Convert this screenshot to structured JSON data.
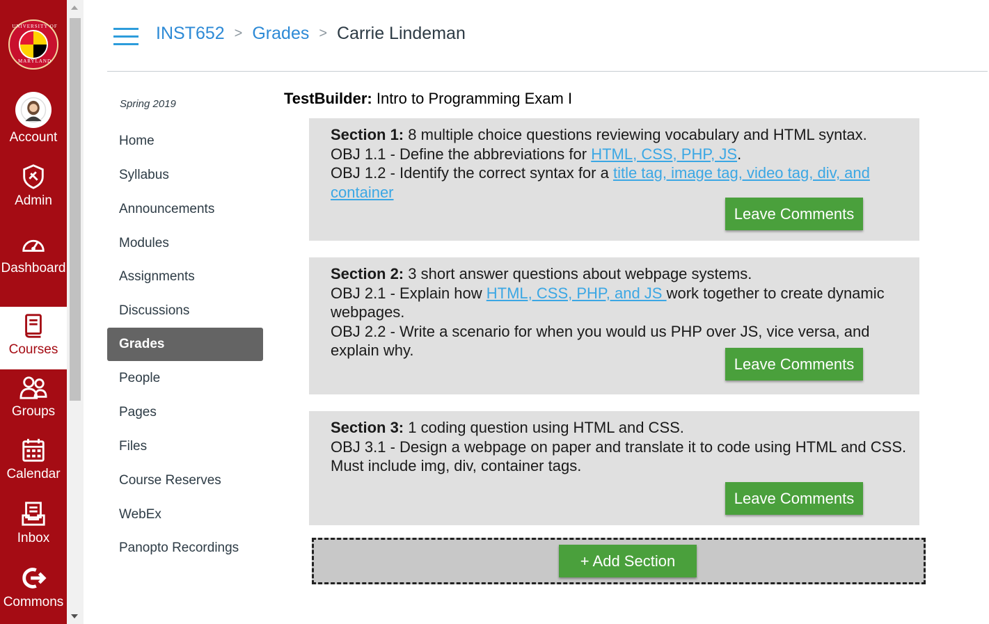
{
  "global_nav": {
    "logo": {
      "top_text": "UNIVERSITY OF",
      "bottom_text": "MARYLAND"
    },
    "items": [
      {
        "label": "Account",
        "icon": "user-avatar-icon"
      },
      {
        "label": "Admin",
        "icon": "shield-icon"
      },
      {
        "label": "Dashboard",
        "icon": "speedometer-icon"
      },
      {
        "label": "Courses",
        "icon": "book-icon",
        "active": true
      },
      {
        "label": "Groups",
        "icon": "people-icon"
      },
      {
        "label": "Calendar",
        "icon": "calendar-icon"
      },
      {
        "label": "Inbox",
        "icon": "inbox-icon"
      },
      {
        "label": "Commons",
        "icon": "share-arrow-icon"
      }
    ]
  },
  "breadcrumb": {
    "course": "INST652",
    "page": "Grades",
    "student": "Carrie Lindeman",
    "separator": ">"
  },
  "course_nav": {
    "term": "Spring 2019",
    "items": [
      "Home",
      "Syllabus",
      "Announcements",
      "Modules",
      "Assignments",
      "Discussions",
      "Grades",
      "People",
      "Pages",
      "Files",
      "Course Reserves",
      "WebEx",
      "Panopto Recordings"
    ],
    "active": "Grades"
  },
  "testbuilder": {
    "label": "TestBuilder:",
    "title": "Intro to Programming Exam I"
  },
  "sections": [
    {
      "heading": "Section 1:",
      "summary": "8 multiple choice questions reviewing vocabulary and HTML syntax.",
      "obj1_pre": "OBJ 1.1 - Define the abbreviations for ",
      "obj1_link": "HTML, CSS, PHP, JS",
      "obj1_post": ".",
      "obj2_pre": "OBJ 1.2 - Identify the correct syntax for a ",
      "obj2_link": "title tag, image tag, video tag, div, and container",
      "button": "Leave Comments"
    },
    {
      "heading": "Section 2:",
      "summary": "3 short answer questions about webpage systems.",
      "obj1_pre": "OBJ 2.1 - Explain how ",
      "obj1_link": "HTML, CSS, PHP, and JS ",
      "obj1_post": "work together to create dynamic webpages.",
      "obj2": "OBJ 2.2 - Write a scenario for when you would us PHP over JS, vice versa, and explain why.",
      "button": "Leave Comments"
    },
    {
      "heading": "Section 3:",
      "summary": "1 coding question using HTML and CSS.",
      "obj1": "OBJ 3.1 - Design a webpage on paper and translate it to code using HTML and CSS. Must include img, div, container tags.",
      "button": "Leave Comments"
    }
  ],
  "add_section_label": "+ Add Section",
  "colors": {
    "nav_red": "#a50c14",
    "link_blue": "#2d8ad6",
    "button_green": "#4aa03c",
    "section_gray": "#e0e0e0"
  }
}
